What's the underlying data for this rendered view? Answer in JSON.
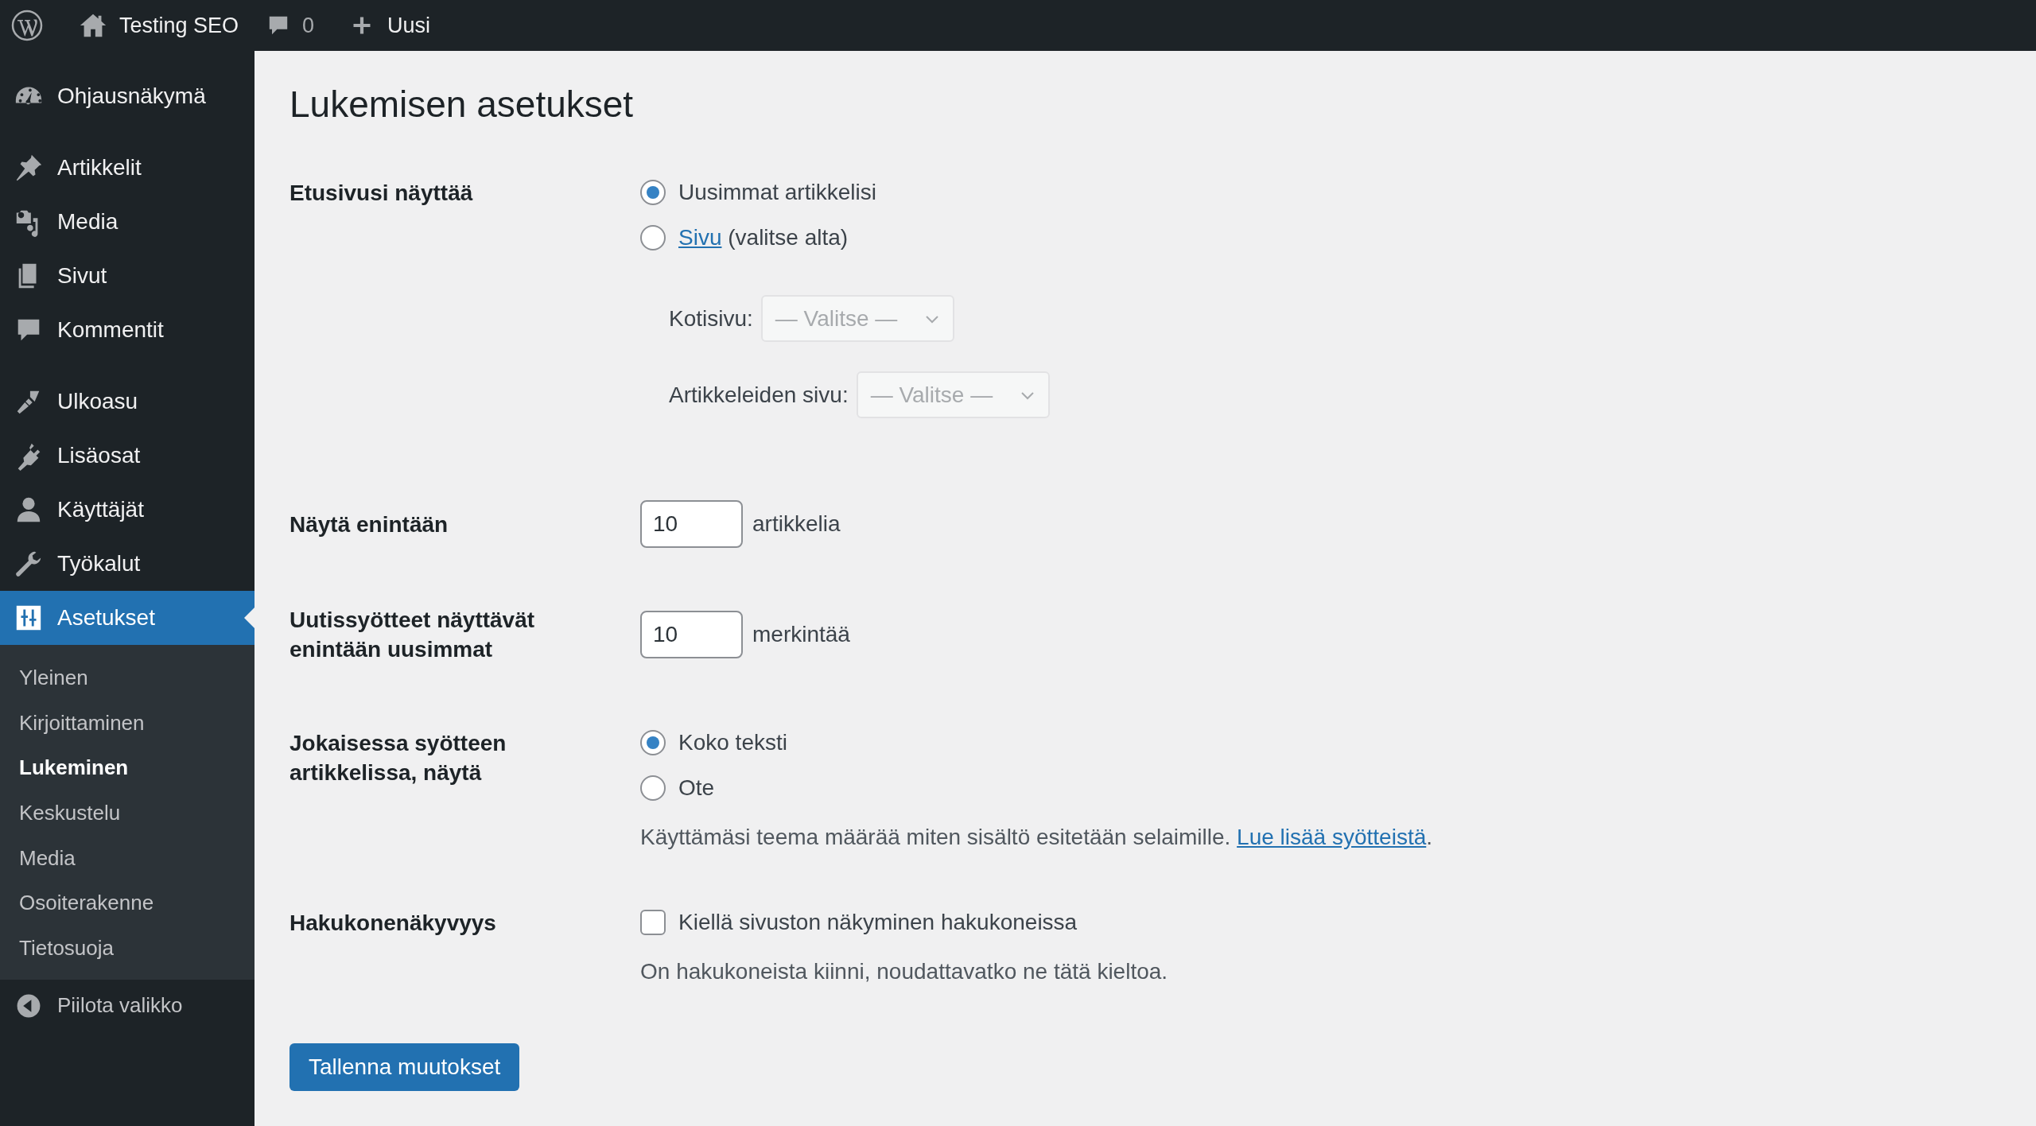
{
  "admin_bar": {
    "site_name": "Testing SEO",
    "comment_count": "0",
    "new_label": "Uusi"
  },
  "sidebar": {
    "menu_groups": [
      [
        {
          "label": "Ohjausnäkymä",
          "selected": false
        }
      ],
      [
        {
          "label": "Artikkelit",
          "selected": false
        },
        {
          "label": "Media",
          "selected": false
        },
        {
          "label": "Sivut",
          "selected": false
        },
        {
          "label": "Kommentit",
          "selected": false
        }
      ],
      [
        {
          "label": "Ulkoasu",
          "selected": false
        },
        {
          "label": "Lisäosat",
          "selected": false
        },
        {
          "label": "Käyttäjät",
          "selected": false
        },
        {
          "label": "Työkalut",
          "selected": false
        },
        {
          "label": "Asetukset",
          "selected": true,
          "submenu": [
            {
              "label": "Yleinen",
              "selected": false
            },
            {
              "label": "Kirjoittaminen",
              "selected": false
            },
            {
              "label": "Lukeminen",
              "selected": true
            },
            {
              "label": "Keskustelu",
              "selected": false
            },
            {
              "label": "Media",
              "selected": false
            },
            {
              "label": "Osoiterakenne",
              "selected": false
            },
            {
              "label": "Tietosuoja",
              "selected": false
            }
          ]
        }
      ]
    ],
    "collapse_label": "Piilota valikko"
  },
  "page_title": "Lukemisen asetukset",
  "settings": [
    {
      "kind": "radio_group",
      "label": "Etusivusi näyttää",
      "options": [
        {
          "text": "Uusimmat artikkelisi",
          "selected": true
        },
        {
          "link": "Sivu",
          "text": "(valitse alta)",
          "selected": false
        }
      ],
      "selects": [
        {
          "label": "Kotisivu:",
          "value": "— Valitse —",
          "disabled": true
        },
        {
          "label": "Artikkeleiden sivu:",
          "value": "— Valitse —",
          "disabled": true
        }
      ]
    },
    {
      "kind": "number",
      "label": "Näytä enintään",
      "value": "10",
      "unit": "artikkelia"
    },
    {
      "kind": "number",
      "label": "Uutissyötteet näyttävät enintään uusimmat",
      "value": "10",
      "unit": "merkintää"
    },
    {
      "kind": "radio_group",
      "label": "Jokaisessa syötteen artikkelissa, näytä",
      "options": [
        {
          "text": "Koko teksti",
          "selected": true
        },
        {
          "text": "Ote",
          "selected": false
        }
      ],
      "help": {
        "text": "Käyttämäsi teema määrää miten sisältö esitetään selaimille.",
        "link": "Lue lisää syötteistä",
        "suffix": "."
      }
    },
    {
      "kind": "checkbox",
      "label": "Hakukonenäkyvyys",
      "option": {
        "text": "Kiellä sivuston näkyminen hakukoneissa",
        "checked": false
      },
      "help": {
        "text": "On hakukoneista kiinni, noudattavatko ne tätä kieltoa."
      }
    }
  ],
  "save_button": "Tallenna muutokset"
}
